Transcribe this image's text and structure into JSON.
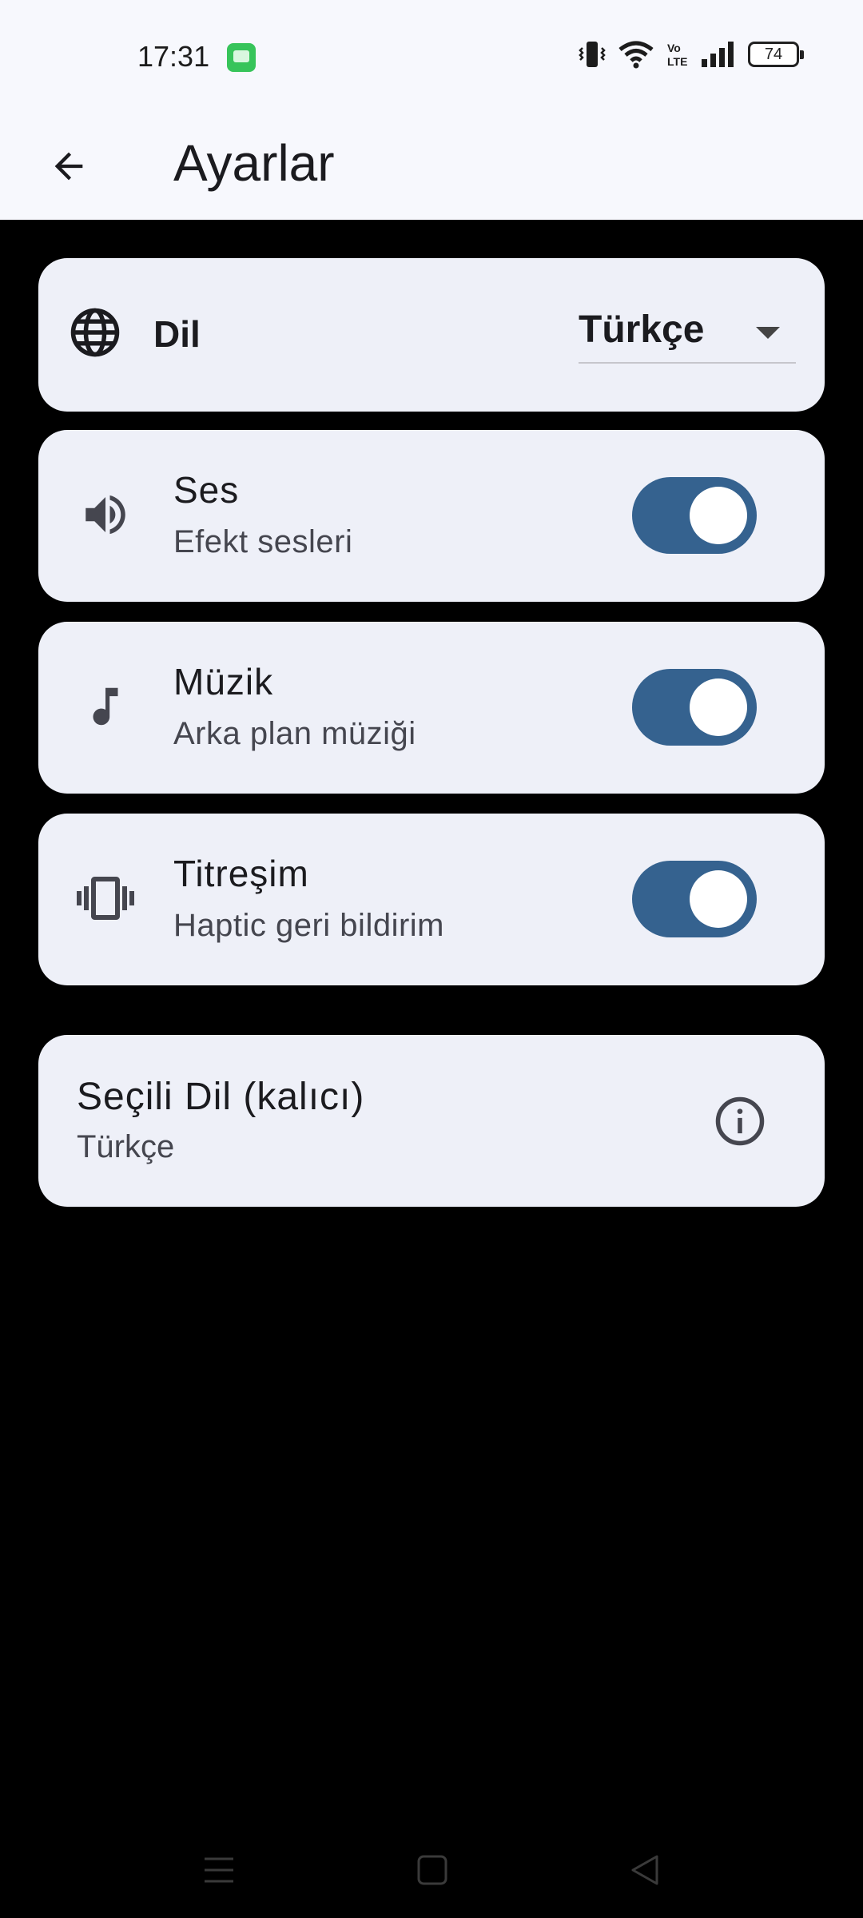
{
  "status_bar": {
    "time": "17:31",
    "battery": "74",
    "icons": [
      "messages-icon",
      "vibrate-mode-icon",
      "wifi-icon",
      "volte-icon",
      "signal-icon",
      "battery-icon"
    ]
  },
  "app_bar": {
    "title": "Ayarlar",
    "back_icon": "arrow-back-icon"
  },
  "language": {
    "label": "Dil",
    "selected": "Türkçe",
    "icon": "globe-icon"
  },
  "settings": [
    {
      "title": "Ses",
      "subtitle": "Efekt sesleri",
      "icon": "volume-icon",
      "enabled": true
    },
    {
      "title": "Müzik",
      "subtitle": "Arka plan müziği",
      "icon": "music-note-icon",
      "enabled": true
    },
    {
      "title": "Titreşim",
      "subtitle": "Haptic geri bildirim",
      "icon": "vibration-icon",
      "enabled": true
    }
  ],
  "saved_language": {
    "title": "Seçili Dil (kalıcı)",
    "value": "Türkçe",
    "icon": "info-icon"
  },
  "colors": {
    "accent": "#35628f",
    "card": "#eef0f8",
    "app_bar": "#f7f8fd",
    "background": "#000000"
  },
  "nav_bar": {
    "icons": [
      "menu-icon",
      "home-icon",
      "back-triangle-icon"
    ]
  }
}
